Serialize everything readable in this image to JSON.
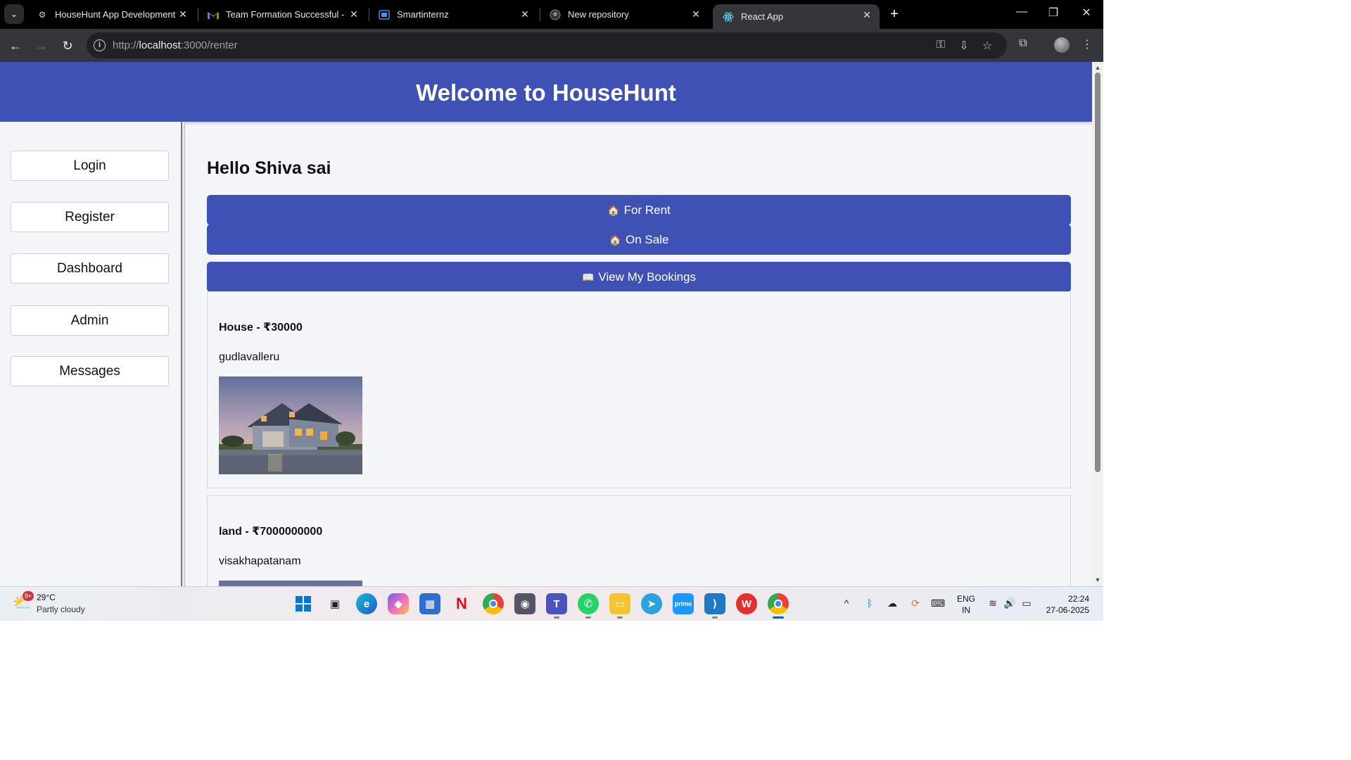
{
  "browser": {
    "tabs": [
      {
        "title": "HouseHunt App Development",
        "icon": "gear-icon"
      },
      {
        "title": "Team Formation Successful - Sm",
        "icon": "gmail-icon"
      },
      {
        "title": "Smartinternz",
        "icon": "smartinternz-icon"
      },
      {
        "title": "New repository",
        "icon": "github-icon"
      },
      {
        "title": "React App",
        "icon": "react-icon"
      }
    ],
    "url_prefix": "http://",
    "url_host": "localhost",
    "url_rest": ":3000/renter"
  },
  "page": {
    "banner_title": "Welcome to HouseHunt",
    "sidebar": [
      "Login",
      "Register",
      "Dashboard",
      "Admin",
      "Messages"
    ],
    "greeting": "Hello Shiva sai",
    "buttons": {
      "for_rent": "For Rent",
      "on_sale": "On Sale",
      "bookings": "View My Bookings"
    },
    "listings": [
      {
        "title": "House - ₹30000",
        "location": "gudlavalleru"
      },
      {
        "title": "land - ₹7000000000",
        "location": "visakhapatanam"
      }
    ]
  },
  "taskbar": {
    "weather_badge": "9+",
    "temperature": "29°C",
    "condition": "Partly cloudy",
    "lang_top": "ENG",
    "lang_bottom": "IN",
    "time": "22:24",
    "date": "27-06-2025"
  },
  "colors": {
    "brand": "#3f51b5",
    "page_bg": "#f4f5f8"
  }
}
